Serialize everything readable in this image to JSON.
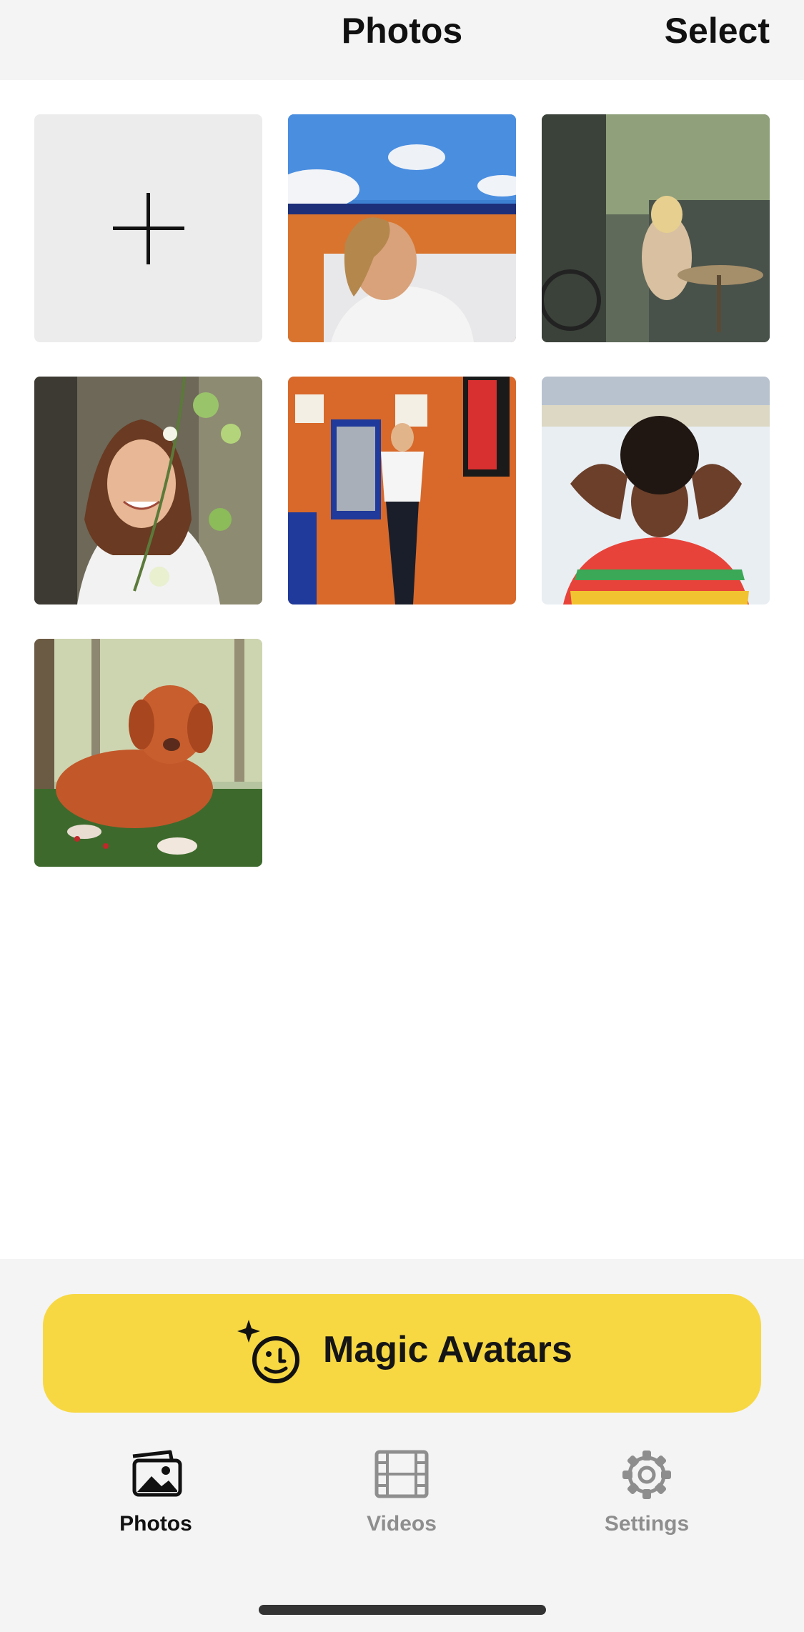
{
  "header": {
    "title": "Photos",
    "select_label": "Select"
  },
  "grid": {
    "add_tile_icon": "plus-icon",
    "photos": [
      {
        "subject": "man-looking-up-sky"
      },
      {
        "subject": "woman-at-cafe-table"
      },
      {
        "subject": "smiling-woman-flowers"
      },
      {
        "subject": "man-against-brick-wall"
      },
      {
        "subject": "woman-hands-behind-head"
      },
      {
        "subject": "dog-lying-on-grass"
      }
    ]
  },
  "magic_button": {
    "label": "Magic Avatars",
    "icon": "sparkle-face-icon",
    "color": "#f7d843"
  },
  "tabbar": {
    "tabs": [
      {
        "label": "Photos",
        "icon": "photos-icon",
        "active": true
      },
      {
        "label": "Videos",
        "icon": "film-icon",
        "active": false
      },
      {
        "label": "Settings",
        "icon": "gear-icon",
        "active": false
      }
    ],
    "active_color": "#111111",
    "inactive_color": "#8e8e8e"
  }
}
